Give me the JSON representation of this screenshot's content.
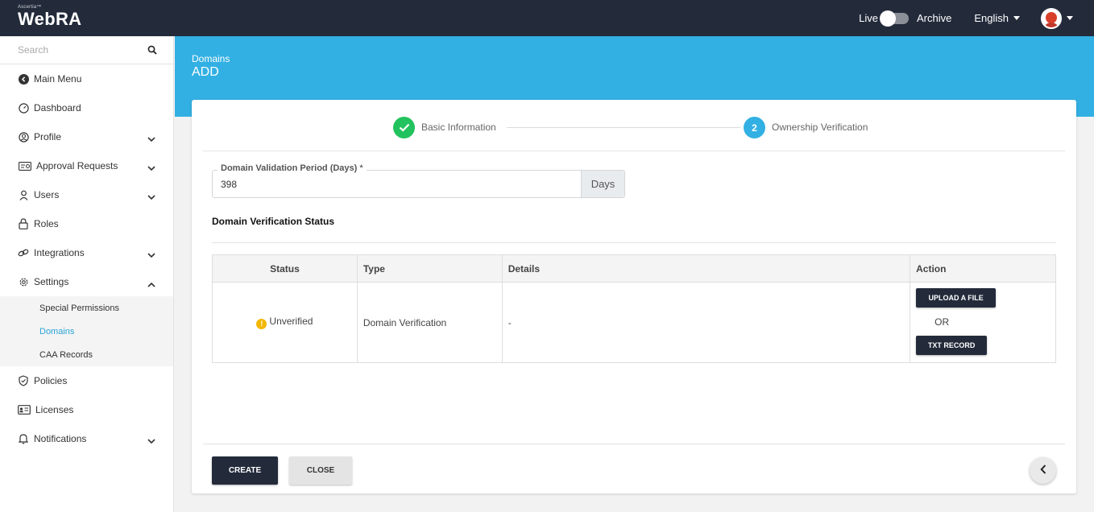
{
  "header": {
    "brand_small": "Ascertia™",
    "brand": "WebRA",
    "live_label": "Live",
    "archive_label": "Archive",
    "language": "English"
  },
  "sidebar": {
    "search_placeholder": "Search",
    "items": [
      {
        "label": "Main Menu",
        "icon": "back-circle-icon"
      },
      {
        "label": "Dashboard",
        "icon": "dashboard-icon"
      },
      {
        "label": "Profile",
        "icon": "profile-icon"
      },
      {
        "label": "Approval Requests",
        "icon": "approval-icon"
      },
      {
        "label": "Users",
        "icon": "users-icon"
      },
      {
        "label": "Roles",
        "icon": "lock-icon"
      },
      {
        "label": "Integrations",
        "icon": "link-icon"
      },
      {
        "label": "Settings",
        "icon": "gear-icon"
      }
    ],
    "settings_sub": [
      "Special Permissions",
      "Domains",
      "CAA Records"
    ],
    "items_after": [
      {
        "label": "Policies",
        "icon": "shield-icon"
      },
      {
        "label": "Licenses",
        "icon": "id-card-icon"
      },
      {
        "label": "Notifications",
        "icon": "bell-icon"
      }
    ]
  },
  "page": {
    "breadcrumb": "Domains",
    "title": "ADD"
  },
  "stepper": {
    "step1_label": "Basic Information",
    "step2_number": "2",
    "step2_label": "Ownership Verification"
  },
  "form": {
    "validation_label": "Domain Validation Period (Days)",
    "required_mark": "*",
    "validation_value": "398",
    "validation_suffix": "Days"
  },
  "verification": {
    "section_title": "Domain Verification Status",
    "columns": [
      "Status",
      "Type",
      "Details",
      "Action"
    ],
    "row": {
      "status": "Unverified",
      "type": "Domain Verification",
      "details": "-",
      "upload_label": "UPLOAD A FILE",
      "or_label": "OR",
      "txt_label": "TXT RECORD"
    }
  },
  "footer": {
    "create_label": "CREATE",
    "close_label": "CLOSE"
  },
  "colors": {
    "topbar": "#232b3b",
    "banner": "#32b0e3",
    "success": "#22c35e",
    "warning": "#f2b705",
    "active_link": "#2aa3d8"
  }
}
